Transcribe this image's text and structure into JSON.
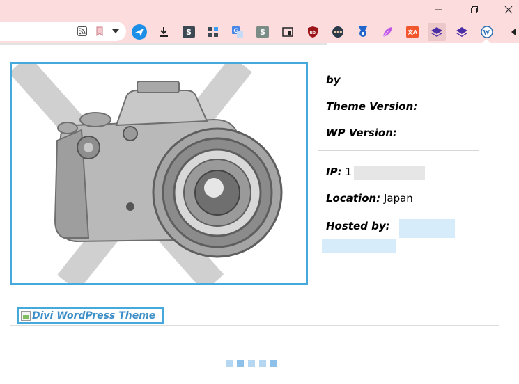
{
  "window": {
    "controls": [
      {
        "name": "minimize",
        "glyph": "—"
      },
      {
        "name": "restore",
        "glyph": "❐"
      },
      {
        "name": "close",
        "glyph": "✕"
      }
    ]
  },
  "extensions": [
    {
      "name": "feed",
      "letter": "",
      "color": "#555555"
    },
    {
      "name": "bookmark",
      "letter": "",
      "color": "#c97a86"
    },
    {
      "name": "plane",
      "letter": "",
      "color": "#1e8fe6"
    },
    {
      "name": "download",
      "letter": "",
      "color": "#222222"
    },
    {
      "name": "s-dark",
      "letter": "S",
      "color": "#3c4852"
    },
    {
      "name": "grid",
      "letter": "",
      "color": "#3b6cd6"
    },
    {
      "name": "translate",
      "letter": "G",
      "color": "#4a86e8"
    },
    {
      "name": "s-gray",
      "letter": "S",
      "color": "#7b8b85"
    },
    {
      "name": "pip",
      "letter": "",
      "color": "#222222"
    },
    {
      "name": "ublock",
      "letter": "ub",
      "color": "#9c1417"
    },
    {
      "name": "ninja",
      "letter": "",
      "color": "#2b3b4a"
    },
    {
      "name": "medal",
      "letter": "",
      "color": "#2266cc"
    },
    {
      "name": "feather",
      "letter": "",
      "color": "#c058e8"
    },
    {
      "name": "translator",
      "letter": "文A",
      "color": "#f2562d"
    },
    {
      "name": "layers-active",
      "letter": "",
      "color": "#4b2ea6"
    },
    {
      "name": "layers",
      "letter": "",
      "color": "#4b2ea6"
    },
    {
      "name": "wordpress",
      "letter": "W",
      "color": "#2f6fb3"
    },
    {
      "name": "more",
      "letter": "",
      "color": "#222222"
    }
  ],
  "theme_info": {
    "by_label": "by",
    "theme_version_label": "Theme Version:",
    "wp_version_label": "WP Version:",
    "ip_label": "IP:",
    "ip_value_visible": "1",
    "location_label": "Location:",
    "location_value": "Japan",
    "hosted_by_label": "Hosted by:"
  },
  "theme_link": {
    "alt_text": "Divi WordPress Theme"
  },
  "colors": {
    "accent": "#46a9dc",
    "chrome": "#fcdcdd",
    "link": "#3b8ec8"
  }
}
